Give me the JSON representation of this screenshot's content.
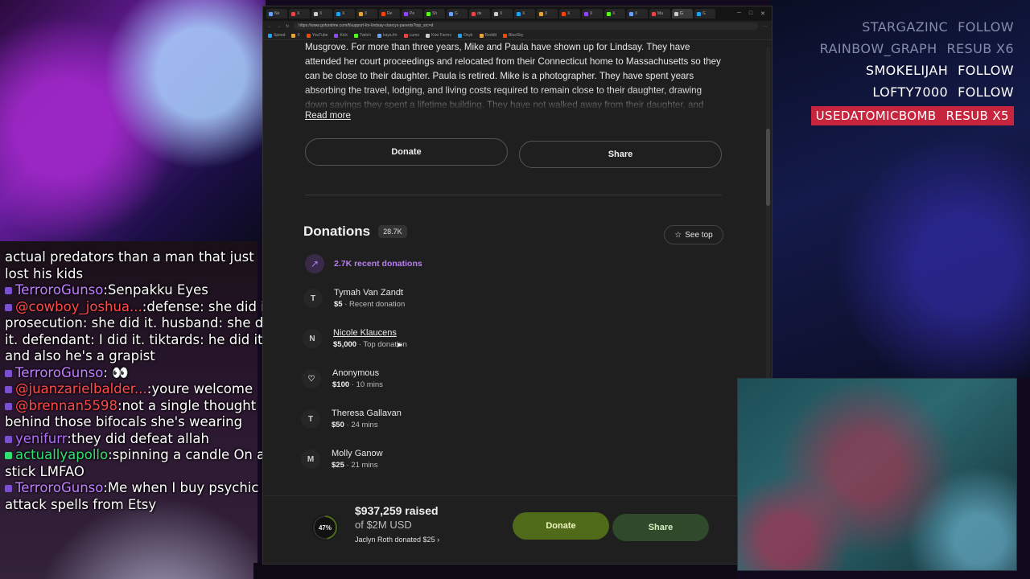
{
  "alerts": [
    {
      "user": "STARGAZINC",
      "action": "FOLLOW",
      "style": "dim"
    },
    {
      "user": "RAINBOW_GRAPH",
      "action": "RESUB X6",
      "style": "dim"
    },
    {
      "user": "SMOKELIJAH",
      "action": "FOLLOW",
      "style": "normal"
    },
    {
      "user": "LOFTY7000",
      "action": "FOLLOW",
      "style": "normal"
    },
    {
      "user": "USEDATOMICBOMB",
      "action": "RESUB X5",
      "style": "highlight"
    }
  ],
  "chat": [
    {
      "user": "",
      "text": "actual predators than a man that just lost his kids",
      "color": ""
    },
    {
      "user": "TerroroGunso",
      "text": ":Senpakku Eyes",
      "color": "purple"
    },
    {
      "user": "@cowboy_joshua...",
      "text": ":defense: she did it. prosecution: she did it. husband: she did it. defendant: I did it. tiktards: he did it and also he's a grapist",
      "color": "red"
    },
    {
      "user": "TerroroGunso",
      "text": ": 👀",
      "color": "purple"
    },
    {
      "user": "@juanzarielbalder...",
      "text": ":youre welcome",
      "color": "red"
    },
    {
      "user": "@brennan5598",
      "text": ":not a single thought behind those bifocals she's wearing",
      "color": "red"
    },
    {
      "user": "yenifurr",
      "text": ":they did defeat allah",
      "color": "violet"
    },
    {
      "user": "actuallyapollo",
      "text": ":spinning a candle On a stick LMFAO",
      "color": "green"
    },
    {
      "user": "TerroroGunso",
      "text": ":Me when I buy psychic attack spells from Etsy",
      "color": "purple"
    }
  ],
  "browser": {
    "tabs": [
      "Ne",
      "X",
      "X",
      "X",
      "X",
      "Re",
      "Pe",
      "Sh",
      "G",
      "de",
      "X",
      "X",
      "X",
      "X",
      "X",
      "X",
      "X",
      "Ma",
      "G",
      "G"
    ],
    "url": "https://www.gofundme.com/f/support-for-lindsay-clancys-parents?top_src=d",
    "bookmarks": [
      "Speed",
      "X",
      "YouTube",
      "Kick",
      "Twitch",
      "kaya.fm",
      "Lumo",
      "Kiwi Farms",
      "Onyk",
      "Reddit",
      "BlueSky"
    ]
  },
  "story": {
    "text": "Musgrove. For more than three years, Mike and Paula have shown up for Lindsay. They have attended her court proceedings and relocated from their Connecticut home to Massachusetts so they can be close to their daughter. Paula is retired. Mike is a photographer. They have spent years absorbing the travel, lodging, and living costs required to remain close to their daughter, drawing down savings they spent a lifetime building. They have not walked away from their daughter, and",
    "read_more": "Read more"
  },
  "actions": {
    "donate": "Donate",
    "share": "Share"
  },
  "donations": {
    "title": "Donations",
    "count": "28.7K",
    "see_top": "See top",
    "recent_label": "2.7K recent donations",
    "items": [
      {
        "initial": "T",
        "name": "Tymah Van Zandt",
        "amount": "$5",
        "note": "Recent donation",
        "link": false
      },
      {
        "initial": "N",
        "name": "Nicole Klaucens",
        "amount": "$5,000",
        "note": "Top donation",
        "link": true
      },
      {
        "initial": "♡",
        "name": "Anonymous",
        "amount": "$100",
        "note": "10 mins",
        "link": false
      },
      {
        "initial": "T",
        "name": "Theresa Gallavan",
        "amount": "$50",
        "note": "24 mins",
        "link": false
      },
      {
        "initial": "M",
        "name": "Molly Ganow",
        "amount": "$25",
        "note": "21 mins",
        "link": false
      }
    ]
  },
  "summary": {
    "percent": "47%",
    "percent_value": 0.47,
    "raised": "$937,259 raised",
    "goal": "of $2M USD",
    "recent": "Jaclyn Roth donated $25",
    "donate": "Donate",
    "share": "Share"
  },
  "colors": {
    "accent_purple": "#b77ef2",
    "donate_green": "#4f6b1a",
    "alert_red": "#c6253d"
  }
}
